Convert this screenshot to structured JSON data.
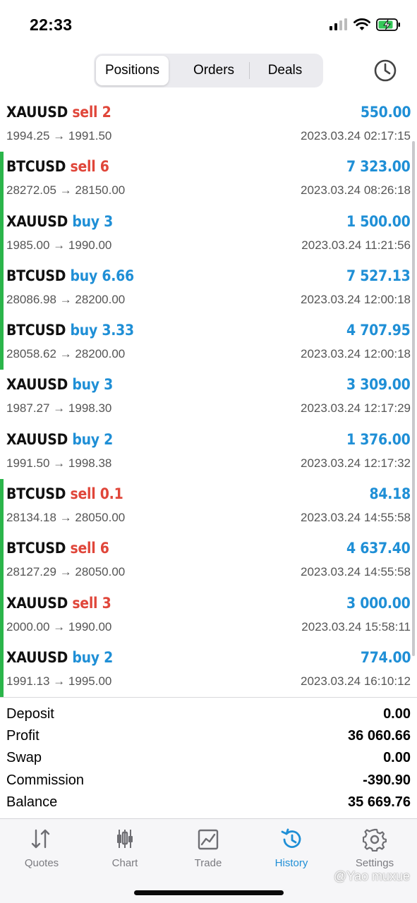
{
  "status_bar": {
    "time": "22:33"
  },
  "tabs_top": {
    "items": [
      {
        "label": "Positions",
        "active": true
      },
      {
        "label": "Orders",
        "active": false
      },
      {
        "label": "Deals",
        "active": false
      }
    ]
  },
  "rows": [
    {
      "symbol": "XAUUSD",
      "side": "sell",
      "volume": "2",
      "price_open": "1994.25",
      "price_close": "1991.50",
      "profit": "550.00",
      "time": "2023.03.24 02:17:15",
      "bar": false
    },
    {
      "symbol": "BTCUSD",
      "side": "sell",
      "volume": "6",
      "price_open": "28272.05",
      "price_close": "28150.00",
      "profit": "7 323.00",
      "time": "2023.03.24 08:26:18",
      "bar": true
    },
    {
      "symbol": "XAUUSD",
      "side": "buy",
      "volume": "3",
      "price_open": "1985.00",
      "price_close": "1990.00",
      "profit": "1 500.00",
      "time": "2023.03.24 11:21:56",
      "bar": true
    },
    {
      "symbol": "BTCUSD",
      "side": "buy",
      "volume": "6.66",
      "price_open": "28086.98",
      "price_close": "28200.00",
      "profit": "7 527.13",
      "time": "2023.03.24 12:00:18",
      "bar": true
    },
    {
      "symbol": "BTCUSD",
      "side": "buy",
      "volume": "3.33",
      "price_open": "28058.62",
      "price_close": "28200.00",
      "profit": "4 707.95",
      "time": "2023.03.24 12:00:18",
      "bar": true
    },
    {
      "symbol": "XAUUSD",
      "side": "buy",
      "volume": "3",
      "price_open": "1987.27",
      "price_close": "1998.30",
      "profit": "3 309.00",
      "time": "2023.03.24 12:17:29",
      "bar": false
    },
    {
      "symbol": "XAUUSD",
      "side": "buy",
      "volume": "2",
      "price_open": "1991.50",
      "price_close": "1998.38",
      "profit": "1 376.00",
      "time": "2023.03.24 12:17:32",
      "bar": false
    },
    {
      "symbol": "BTCUSD",
      "side": "sell",
      "volume": "0.1",
      "price_open": "28134.18",
      "price_close": "28050.00",
      "profit": "84.18",
      "time": "2023.03.24 14:55:58",
      "bar": true
    },
    {
      "symbol": "BTCUSD",
      "side": "sell",
      "volume": "6",
      "price_open": "28127.29",
      "price_close": "28050.00",
      "profit": "4 637.40",
      "time": "2023.03.24 14:55:58",
      "bar": true
    },
    {
      "symbol": "XAUUSD",
      "side": "sell",
      "volume": "3",
      "price_open": "2000.00",
      "price_close": "1990.00",
      "profit": "3 000.00",
      "time": "2023.03.24 15:58:11",
      "bar": true
    },
    {
      "symbol": "XAUUSD",
      "side": "buy",
      "volume": "2",
      "price_open": "1991.13",
      "price_close": "1995.00",
      "profit": "774.00",
      "time": "2023.03.24 16:10:12",
      "bar": true
    }
  ],
  "summary": [
    {
      "label": "Deposit",
      "value": "0.00"
    },
    {
      "label": "Profit",
      "value": "36 060.66"
    },
    {
      "label": "Swap",
      "value": "0.00"
    },
    {
      "label": "Commission",
      "value": "-390.90"
    },
    {
      "label": "Balance",
      "value": "35 669.76"
    }
  ],
  "tabbar": {
    "items": [
      {
        "label": "Quotes",
        "icon": "quotes-icon",
        "active": false
      },
      {
        "label": "Chart",
        "icon": "chart-icon",
        "active": false
      },
      {
        "label": "Trade",
        "icon": "trade-icon",
        "active": false
      },
      {
        "label": "History",
        "icon": "history-icon",
        "active": true
      },
      {
        "label": "Settings",
        "icon": "gear-icon",
        "active": false
      }
    ]
  },
  "watermark": "@Yao muxue",
  "colors": {
    "sell": "#e0463a",
    "buy": "#1f8fd6",
    "profit": "#1f8fd6",
    "bar": "#2bb54a",
    "accent": "#1f8fd6"
  }
}
